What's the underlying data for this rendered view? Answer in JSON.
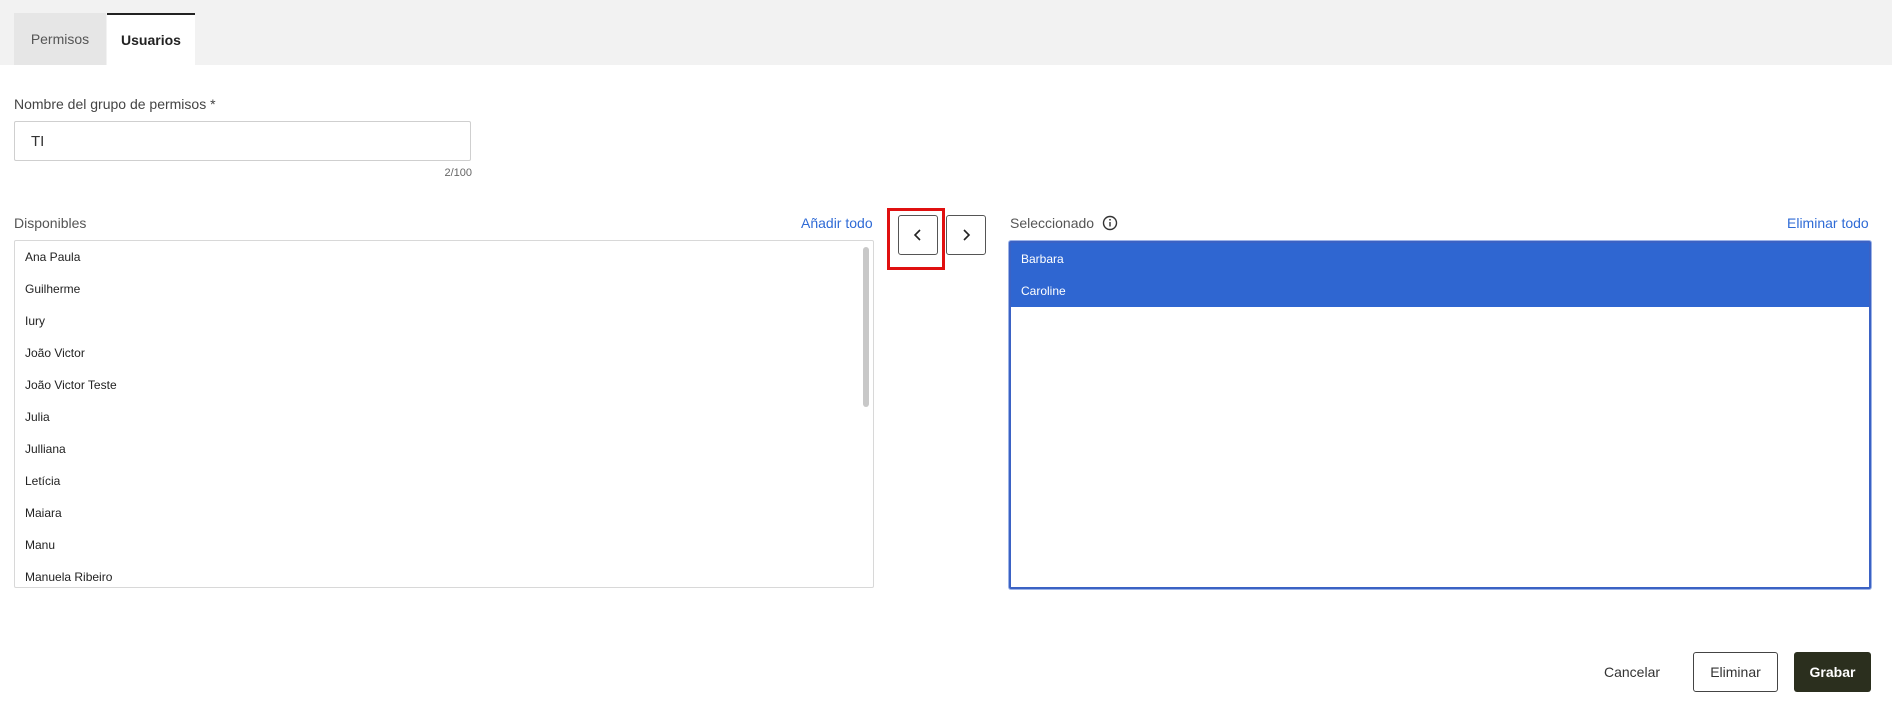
{
  "tabs": [
    {
      "label": "Permisos",
      "active": false
    },
    {
      "label": "Usuarios",
      "active": true
    }
  ],
  "form": {
    "name_label": "Nombre del grupo de permisos *",
    "name_value": "TI",
    "counter": "2/100"
  },
  "available": {
    "title": "Disponibles",
    "add_all_label": "Añadir todo",
    "items": [
      "Ana Paula",
      "Guilherme",
      "Iury",
      "João Victor",
      "João Victor Teste",
      "Julia",
      "Julliana",
      "Letícia",
      "Maiara",
      "Manu",
      "Manuela Ribeiro"
    ]
  },
  "selected": {
    "title": "Seleccionado",
    "remove_all_label": "Eliminar todo",
    "items": [
      "Barbara",
      "Caroline"
    ]
  },
  "transfer": {
    "left_icon": "chevron-left-icon",
    "right_icon": "chevron-right-icon"
  },
  "footer": {
    "cancel_label": "Cancelar",
    "delete_label": "Eliminar",
    "save_label": "Grabar"
  },
  "colors": {
    "accent": "#2f66d1",
    "link": "#2f6bd6",
    "save_bg": "#2b2f1e",
    "highlight": "#e01010"
  }
}
